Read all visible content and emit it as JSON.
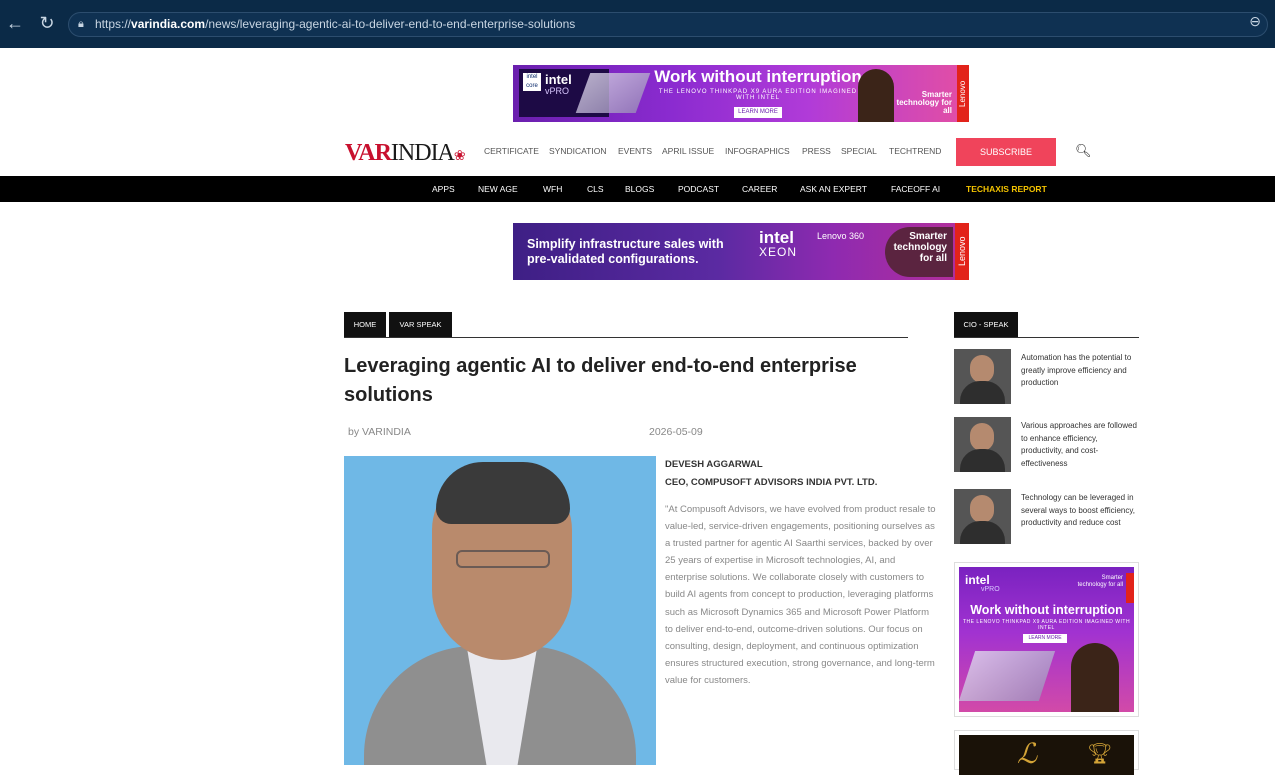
{
  "browser": {
    "url_prefix": "https://",
    "url_host": "varindia.com",
    "url_path": "/news/leveraging-agentic-ai-to-deliver-end-to-end-enterprise-solutions"
  },
  "ad_top": {
    "intel": "intel",
    "vpro": "vPRO",
    "core": "intel core",
    "headline": "Work without interruption",
    "subline": "THE LENOVO THINKPAD X9 AURA EDITION IMAGINED WITH INTEL",
    "cta": "LEARN MORE",
    "smart": "Smarter technology for all",
    "lenovo": "Lenovo"
  },
  "header": {
    "logo_var": "VAR",
    "logo_india": "INDIA",
    "nav": [
      "CERTIFICATE",
      "SYNDICATION",
      "EVENTS",
      "APRIL ISSUE",
      "INFOGRAPHICS",
      "PRESS",
      "SPECIAL",
      "TECHTREND"
    ],
    "subscribe": "SUBSCRIBE"
  },
  "black_nav": [
    "APPS",
    "NEW AGE",
    "WFH",
    "CLS",
    "BLOGS",
    "PODCAST",
    "CAREER",
    "ASK AN EXPERT",
    "FACEOFF AI",
    "TECHAXIS REPORT"
  ],
  "ad_mid": {
    "text": "Simplify infrastructure sales with pre-validated configurations.",
    "intel": "intel",
    "xeon": "XEON",
    "lenovo360": "Lenovo 360",
    "smart": "Smarter technology for all",
    "lenovo": "Lenovo"
  },
  "breadcrumb": [
    "HOME",
    "VAR SPEAK"
  ],
  "article": {
    "title": "Leveraging agentic AI to deliver end-to-end enterprise solutions",
    "by": "by VARINDIA",
    "date": "2026-05-09",
    "author_name": "DEVESH AGGARWAL",
    "author_title": "CEO, COMPUSOFT ADVISORS INDIA PVT. LTD.",
    "quote": "\"At Compusoft Advisors, we have evolved from product resale to value-led, service-driven engagements, positioning ourselves as a trusted partner for agentic AI Saarthi services, backed by over 25 years of expertise in Microsoft technologies, AI, and enterprise solutions. We collaborate closely with customers to build AI agents from concept to production, leveraging platforms such as Microsoft Dynamics 365 and Microsoft Power Platform to deliver end-to-end, outcome-driven solutions. Our focus on consulting, design, deployment, and continuous optimization ensures structured execution, strong governance, and long-term value for customers."
  },
  "sidebar": {
    "tab": "CIO - SPEAK",
    "items": [
      "Automation has the potential to greatly improve efficiency and production",
      "Various approaches are followed to enhance efficiency, productivity, and cost-effectiveness",
      "Technology can be leveraged in several ways to boost efficiency, productivity and reduce cost"
    ],
    "ad": {
      "intel": "intel",
      "vpro": "vPRO",
      "smart": "Smarter technology for all",
      "headline": "Work without interruption",
      "subline": "THE LENOVO THINKPAD X9 AURA EDITION IMAGINED WITH INTEL",
      "cta": "LEARN MORE"
    }
  }
}
